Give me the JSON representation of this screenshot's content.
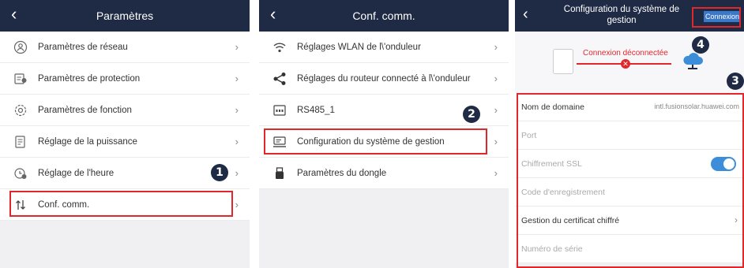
{
  "panel1": {
    "title": "Paramètres",
    "items": [
      {
        "label": "Paramètres de réseau",
        "icon": "network-icon"
      },
      {
        "label": "Paramètres de protection",
        "icon": "protection-icon"
      },
      {
        "label": "Paramètres de fonction",
        "icon": "function-gear-icon"
      },
      {
        "label": "Réglage de la puissance",
        "icon": "power-doc-icon"
      },
      {
        "label": "Réglage de l'heure",
        "icon": "clock-icon"
      },
      {
        "label": "Conf. comm.",
        "icon": "comm-arrows-icon"
      }
    ],
    "step": "1"
  },
  "panel2": {
    "title": "Conf. comm.",
    "items": [
      {
        "label": "Réglages WLAN de l\\'onduleur",
        "icon": "wifi-icon"
      },
      {
        "label": "Réglages du routeur connecté à l\\'onduleur",
        "icon": "share-icon"
      },
      {
        "label": "RS485_1",
        "icon": "rs485-icon"
      },
      {
        "label": "Configuration du système de gestion",
        "icon": "management-system-icon"
      },
      {
        "label": "Paramètres du dongle",
        "icon": "dongle-icon"
      }
    ],
    "step": "2"
  },
  "panel3": {
    "title": "Configuration du système de gestion",
    "connect_button": "Connexion",
    "status_text": "Connexion déconnectée",
    "fields": [
      {
        "label": "Nom de domaine",
        "value": "intl.fusionsolar.huawei.com"
      },
      {
        "label": "Port",
        "value": ""
      },
      {
        "label": "Chiffrement SSL",
        "value": ""
      },
      {
        "label": "Code d'enregistrement",
        "value": ""
      },
      {
        "label": "Gestion du certificat chiffré",
        "value": ""
      },
      {
        "label": "Numéro de série",
        "value": ""
      }
    ],
    "step3": "3",
    "step4": "4"
  },
  "colors": {
    "header": "#1f2a44",
    "highlight": "#e0282c",
    "accent": "#3c8ed8"
  }
}
